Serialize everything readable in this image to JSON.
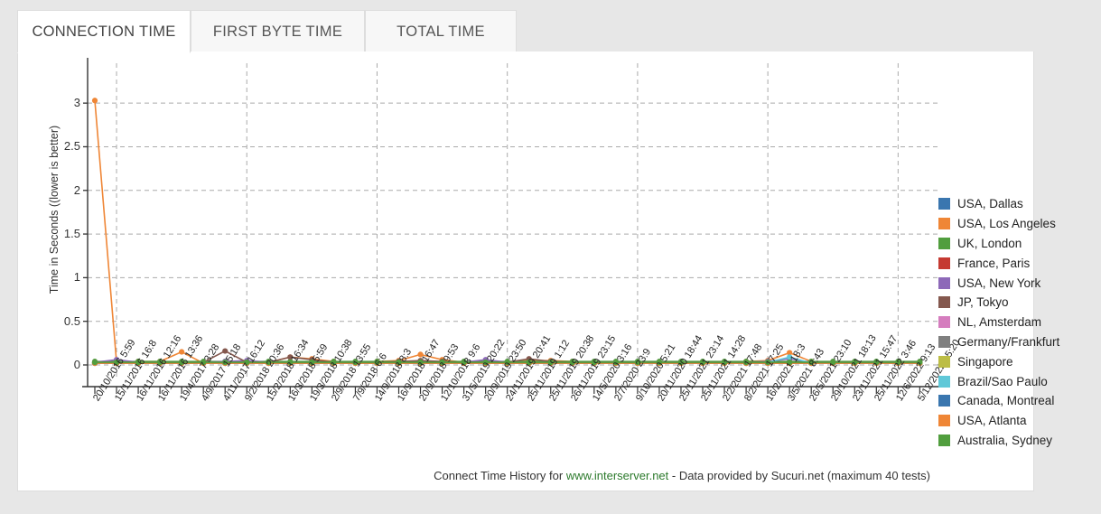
{
  "tabs": [
    {
      "label": "CONNECTION TIME",
      "active": true
    },
    {
      "label": "FIRST BYTE TIME",
      "active": false
    },
    {
      "label": "TOTAL TIME",
      "active": false
    }
  ],
  "caption": {
    "prefix": "Connect Time History for ",
    "site": "www.interserver.net",
    "suffix": " - Data provided by Sucuri.net (maximum 40 tests)"
  },
  "colors": {
    "panel_bg": "#ffffff",
    "page_bg": "#e7e7e7",
    "tab_inactive_bg": "#f7f7f7",
    "border": "#dddddd",
    "grid": "#aaaaaa",
    "axis": "#333333"
  },
  "chart_data": {
    "type": "line",
    "title": "",
    "xlabel": "",
    "ylabel": "Time in Seconds ((lower is better)",
    "ylim": [
      0,
      3.25
    ],
    "yticks": [
      0,
      0.5,
      1,
      1.5,
      2,
      2.5,
      3
    ],
    "ytick_labels": [
      "0",
      "0.5",
      "1",
      "1.5",
      "2",
      "2.5",
      "3"
    ],
    "grid": true,
    "grid_axis": "both",
    "legend_position": "right",
    "gridline_x_indices": [
      1,
      7,
      13,
      19,
      25,
      31,
      37
    ],
    "categories": [
      "20/10/2016 5:59",
      "15/11/2016 16:8",
      "16/11/2016 12:16",
      "16/11/2016 13:36",
      "19/4/2017 3:28",
      "4/9/2017 15:18",
      "4/11/2017 16:12",
      "9/2/2018 20:36",
      "15/2/2018 16:34",
      "16/3/2018 5:59",
      "19/3/2018 10:38",
      "2/9/2018 13:55",
      "7/9/2018 6:6",
      "14/9/2018 8:3",
      "16/9/2018 16:47",
      "20/9/2018 9:53",
      "12/10/2018 9:6",
      "31/5/2019 20:22",
      "20/9/2019 23:50",
      "24/11/2019 20:41",
      "25/11/2019 1:12",
      "25/11/2019 20:38",
      "26/11/2019 23:15",
      "14/5/2020 3:16",
      "2/7/2020 23:9",
      "9/10/2020 5:21",
      "20/11/2020 18:44",
      "25/11/2021 23:14",
      "25/11/2021 14:28",
      "2/2/2021 17:48",
      "8/2/2021 17:25",
      "16/2/2021 18:3",
      "3/5/2021 8:43",
      "26/5/2021 23:10",
      "29/10/2021 18:13",
      "23/11/2021 15:47",
      "25/11/2022 3:46",
      "12/6/2022 9:13",
      "5/12/2022 15:20"
    ],
    "series": [
      {
        "name": "USA, Dallas",
        "color": "#3a76af",
        "values": [
          0.02,
          0.02,
          0.02,
          0.02,
          0.02,
          0.02,
          0.02,
          0.02,
          0.02,
          0.02,
          0.02,
          0.02,
          0.02,
          0.02,
          0.02,
          0.02,
          0.02,
          0.02,
          0.02,
          0.02,
          0.02,
          0.02,
          0.02,
          0.02,
          0.02,
          0.02,
          0.02,
          0.02,
          0.02,
          0.02,
          0.02,
          0.02,
          0.02,
          0.02,
          0.02,
          0.02,
          0.02,
          0.02,
          0.02
        ]
      },
      {
        "name": "USA, Los Angeles",
        "color": "#ef8636",
        "values": [
          3.03,
          0.03,
          0.04,
          0.04,
          0.15,
          0.02,
          0.03,
          0.04,
          0.03,
          0.09,
          0.07,
          0.04,
          0.03,
          0.04,
          0.05,
          0.12,
          0.06,
          0.03,
          0.03,
          0.03,
          0.05,
          0.05,
          0.04,
          0.03,
          0.03,
          0.03,
          0.03,
          0.03,
          0.03,
          0.03,
          0.04,
          0.05,
          0.14,
          0.04,
          0.03,
          0.03,
          0.03,
          0.03,
          0.03
        ]
      },
      {
        "name": "UK, London",
        "color": "#519e3e",
        "values": [
          0.04,
          0.04,
          0.04,
          0.04,
          0.04,
          0.04,
          0.04,
          0.04,
          0.04,
          0.04,
          0.04,
          0.04,
          0.04,
          0.04,
          0.04,
          0.04,
          0.04,
          0.04,
          0.04,
          0.04,
          0.04,
          0.04,
          0.04,
          0.04,
          0.04,
          0.04,
          0.04,
          0.04,
          0.04,
          0.04,
          0.04,
          0.04,
          0.04,
          0.04,
          0.04,
          0.04,
          0.04,
          0.04,
          0.04
        ]
      },
      {
        "name": "France, Paris",
        "color": "#c53a32",
        "values": [
          0.02,
          0.02,
          0.02,
          0.02,
          0.02,
          0.02,
          0.02,
          0.02,
          0.02,
          0.02,
          0.02,
          0.02,
          0.02,
          0.02,
          0.02,
          0.02,
          0.02,
          0.02,
          0.02,
          0.02,
          0.02,
          0.02,
          0.02,
          0.02,
          0.02,
          0.02,
          0.02,
          0.02,
          0.02,
          0.02,
          0.02,
          0.02,
          0.02,
          0.02,
          0.02,
          0.02,
          0.02,
          0.02,
          0.02
        ]
      },
      {
        "name": "USA, New York",
        "color": "#8d69b8",
        "values": [
          0.03,
          0.06,
          0.03,
          0.03,
          0.03,
          0.03,
          0.04,
          0.05,
          0.03,
          0.03,
          0.03,
          0.03,
          0.03,
          0.03,
          0.03,
          0.03,
          0.03,
          0.03,
          0.06,
          0.03,
          0.03,
          0.03,
          0.03,
          0.03,
          0.03,
          0.03,
          0.03,
          0.03,
          0.03,
          0.03,
          0.03,
          0.04,
          0.07,
          0.03,
          0.03,
          0.03,
          0.03,
          0.03,
          0.03
        ]
      },
      {
        "name": "JP, Tokyo",
        "color": "#84584e",
        "values": [
          0.03,
          0.03,
          0.03,
          0.03,
          0.03,
          0.03,
          0.16,
          0.03,
          0.03,
          0.09,
          0.06,
          0.03,
          0.03,
          0.03,
          0.04,
          0.05,
          0.04,
          0.03,
          0.03,
          0.03,
          0.07,
          0.04,
          0.03,
          0.03,
          0.03,
          0.03,
          0.03,
          0.03,
          0.03,
          0.03,
          0.03,
          0.03,
          0.03,
          0.03,
          0.03,
          0.03,
          0.03,
          0.03,
          0.03
        ]
      },
      {
        "name": "NL, Amsterdam",
        "color": "#d57dbe",
        "values": [
          0.02,
          0.02,
          0.02,
          0.02,
          0.02,
          0.02,
          0.02,
          0.02,
          0.02,
          0.02,
          0.02,
          0.02,
          0.02,
          0.02,
          0.02,
          0.02,
          0.02,
          0.02,
          0.02,
          0.02,
          0.02,
          0.02,
          0.02,
          0.02,
          0.02,
          0.02,
          0.02,
          0.02,
          0.02,
          0.02,
          0.02,
          0.02,
          0.02,
          0.02,
          0.02,
          0.02,
          0.02,
          0.02,
          0.02
        ]
      },
      {
        "name": "Germany/Frankfurt",
        "color": "#7f7f7f",
        "values": [
          0.02,
          0.02,
          0.02,
          0.02,
          0.02,
          0.02,
          0.02,
          0.02,
          0.02,
          0.02,
          0.02,
          0.02,
          0.02,
          0.02,
          0.02,
          0.02,
          0.02,
          0.02,
          0.02,
          0.02,
          0.02,
          0.02,
          0.02,
          0.02,
          0.02,
          0.02,
          0.02,
          0.02,
          0.02,
          0.02,
          0.02,
          0.02,
          0.02,
          0.02,
          0.02,
          0.02,
          0.02,
          0.02,
          0.02
        ]
      },
      {
        "name": "Singapore",
        "color": "#bcbd45",
        "values": [
          0.02,
          0.02,
          0.02,
          0.02,
          0.02,
          0.02,
          0.02,
          0.02,
          0.02,
          0.02,
          0.02,
          0.02,
          0.02,
          0.02,
          0.02,
          0.02,
          0.02,
          0.02,
          0.02,
          0.02,
          0.02,
          0.02,
          0.02,
          0.02,
          0.02,
          0.02,
          0.02,
          0.02,
          0.02,
          0.02,
          0.02,
          0.02,
          0.02,
          0.02,
          0.02,
          0.02,
          0.02,
          0.02,
          0.02
        ]
      },
      {
        "name": "Brazil/Sao Paulo",
        "color": "#5fc8d8",
        "values": [
          0.02,
          0.02,
          0.02,
          0.02,
          0.02,
          0.02,
          0.02,
          0.02,
          0.02,
          0.02,
          0.02,
          0.02,
          0.02,
          0.02,
          0.02,
          0.02,
          0.02,
          0.02,
          0.02,
          0.02,
          0.02,
          0.02,
          0.02,
          0.02,
          0.02,
          0.02,
          0.02,
          0.02,
          0.02,
          0.02,
          0.02,
          0.03,
          0.09,
          0.02,
          0.02,
          0.02,
          0.02,
          0.02,
          0.02
        ]
      },
      {
        "name": "Canada, Montreal",
        "color": "#3a76af",
        "values": [
          0.02,
          0.02,
          0.02,
          0.02,
          0.02,
          0.02,
          0.02,
          0.02,
          0.02,
          0.02,
          0.02,
          0.02,
          0.02,
          0.02,
          0.02,
          0.02,
          0.02,
          0.02,
          0.02,
          0.02,
          0.02,
          0.02,
          0.02,
          0.02,
          0.02,
          0.02,
          0.02,
          0.02,
          0.02,
          0.02,
          0.02,
          0.02,
          0.02,
          0.02,
          0.02,
          0.02,
          0.02,
          0.02,
          0.02
        ]
      },
      {
        "name": "USA, Atlanta",
        "color": "#ef8636",
        "values": [
          0.02,
          0.02,
          0.02,
          0.02,
          0.02,
          0.02,
          0.02,
          0.02,
          0.02,
          0.02,
          0.02,
          0.02,
          0.02,
          0.02,
          0.02,
          0.02,
          0.02,
          0.02,
          0.02,
          0.02,
          0.02,
          0.02,
          0.02,
          0.02,
          0.02,
          0.02,
          0.02,
          0.02,
          0.02,
          0.02,
          0.02,
          0.02,
          0.02,
          0.02,
          0.02,
          0.02,
          0.02,
          0.02,
          0.02
        ]
      },
      {
        "name": "Australia, Sydney",
        "color": "#519e3e",
        "values": [
          0.03,
          0.03,
          0.03,
          0.03,
          0.03,
          0.03,
          0.03,
          0.03,
          0.03,
          0.03,
          0.03,
          0.03,
          0.03,
          0.03,
          0.03,
          0.03,
          0.03,
          0.03,
          0.03,
          0.03,
          0.03,
          0.03,
          0.03,
          0.03,
          0.03,
          0.03,
          0.03,
          0.03,
          0.03,
          0.03,
          0.03,
          0.03,
          0.03,
          0.03,
          0.03,
          0.03,
          0.03,
          0.03,
          0.03
        ]
      }
    ]
  }
}
